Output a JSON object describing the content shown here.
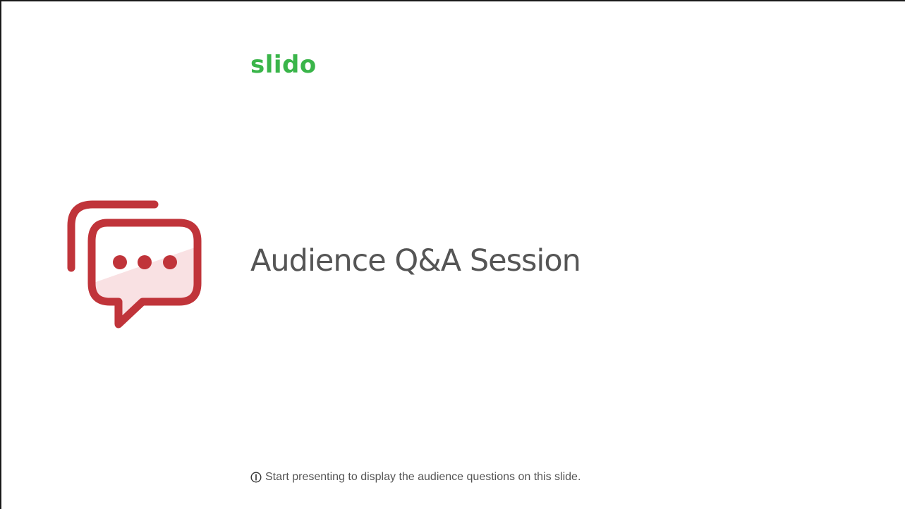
{
  "logo": {
    "text": "slido"
  },
  "icon": {
    "name": "qa-chat-bubbles-icon"
  },
  "slide": {
    "title": "Audience Q&A Session",
    "hint": "Start presenting to display the audience questions on this slide."
  },
  "colors": {
    "brand": "#3ab54a",
    "icon": "#c0343a",
    "text": "#555555"
  }
}
